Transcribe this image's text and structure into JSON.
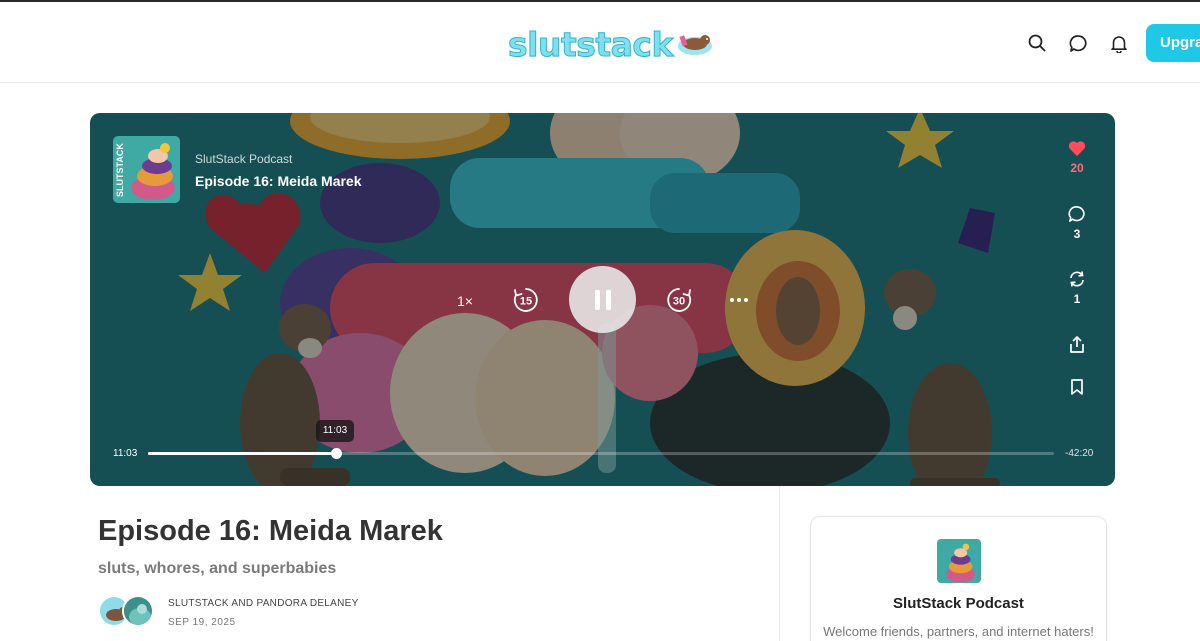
{
  "header": {
    "logo_text": "slutstack",
    "upgrade_label": "Upgra",
    "icons": [
      "search-icon",
      "chat-icon",
      "bell-icon"
    ],
    "accent_color": "#1fc8e6"
  },
  "player": {
    "show_name": "SlutStack Podcast",
    "episode_title": "Episode 16: Meida Marek",
    "cover_text": "SLUTSTACK",
    "speed_label": "1×",
    "skip_back_label": "15",
    "skip_forward_label": "30",
    "state": "playing",
    "elapsed": "11:03",
    "remaining": "-42:20",
    "tooltip": "11:03",
    "progress_fraction": 0.207,
    "like_count": "20",
    "comment_count": "3",
    "restack_count": "1",
    "like_color": "#ff4d5e"
  },
  "episode": {
    "title": "Episode 16: Meida Marek",
    "subtitle": "sluts, whores, and superbabies",
    "authors": "SLUTSTACK AND PANDORA DELANEY",
    "date": "SEP 19, 2025"
  },
  "card": {
    "name": "SlutStack Podcast",
    "description": "Welcome friends, partners, and internet haters!"
  }
}
